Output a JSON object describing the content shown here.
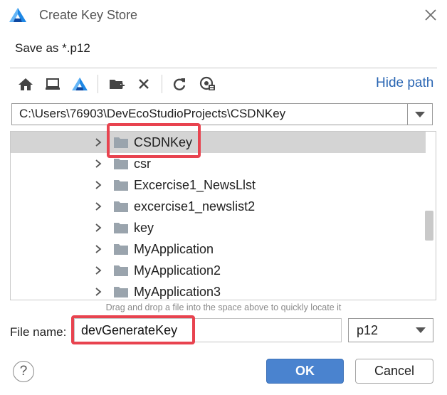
{
  "dialog": {
    "title": "Create Key Store",
    "subtitle": "Save as *.p12"
  },
  "toolbar": {
    "buttons": [
      "home-icon",
      "desktop-icon",
      "project-icon",
      "new-folder-icon",
      "delete-icon",
      "refresh-icon",
      "show-hidden-icon"
    ],
    "hide_path_label": "Hide path"
  },
  "path": {
    "value": "C:\\Users\\76903\\DevEcoStudioProjects\\CSDNKey"
  },
  "tree": {
    "items": [
      {
        "label": "CSDNKey",
        "selected": true
      },
      {
        "label": "csr",
        "selected": false
      },
      {
        "label": "Excercise1_NewsLlst",
        "selected": false
      },
      {
        "label": "excercise1_newslist2",
        "selected": false
      },
      {
        "label": "key",
        "selected": false
      },
      {
        "label": "MyApplication",
        "selected": false
      },
      {
        "label": "MyApplication2",
        "selected": false
      },
      {
        "label": "MyApplication3",
        "selected": false
      }
    ]
  },
  "hint": "Drag and drop a file into the space above to quickly locate it",
  "file_name": {
    "label": "File name:",
    "value": "devGenerateKey"
  },
  "extension": {
    "selected": "p12"
  },
  "buttons": {
    "help": "?",
    "ok": "OK",
    "cancel": "Cancel"
  },
  "colors": {
    "accent": "#4a83cf",
    "link": "#2a66b3",
    "highlight": "#e8434f",
    "selection": "#d4d4d4",
    "folder": "#9aa4ad"
  }
}
